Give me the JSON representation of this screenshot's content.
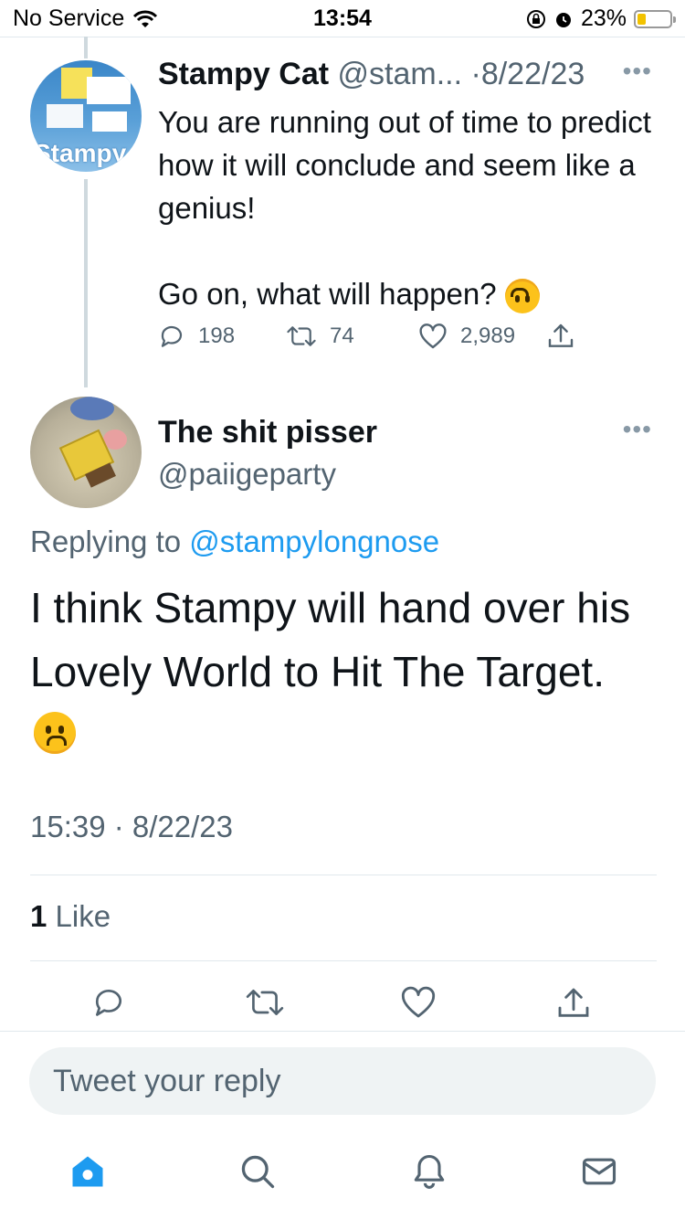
{
  "status_bar": {
    "carrier": "No Service",
    "time": "13:54",
    "battery": "23%",
    "battery_level": 0.23
  },
  "tweet1": {
    "display_name": "Stampy Cat",
    "handle_trunc": "@stam...",
    "date": "8/22/23",
    "avatar_text": "Stampy",
    "text_line1": "You are running out of time to predict how it will conclude and seem like a genius!",
    "text_line2": "Go on, what will happen?",
    "emoji": "upside-down-face",
    "replies": "198",
    "retweets": "74",
    "likes": "2,989"
  },
  "tweet2": {
    "display_name": "The shit pisser",
    "handle": "@paiigeparty",
    "replying_prefix": "Replying to",
    "replying_to": "@stampylongnose",
    "text": "I think Stampy will hand over his Lovely World to Hit The Target.",
    "emoji": "frowning-face",
    "timestamp": "15:39 · 8/22/23",
    "like_count": "1",
    "like_label": "Like"
  },
  "reply": {
    "placeholder": "Tweet your reply"
  },
  "colors": {
    "accent": "#1d9bf0",
    "muted": "#536471",
    "text": "#0f1419",
    "divider": "#e1e8ed"
  },
  "tab_icons": [
    "home-icon",
    "search-icon",
    "notifications-icon",
    "messages-icon"
  ]
}
